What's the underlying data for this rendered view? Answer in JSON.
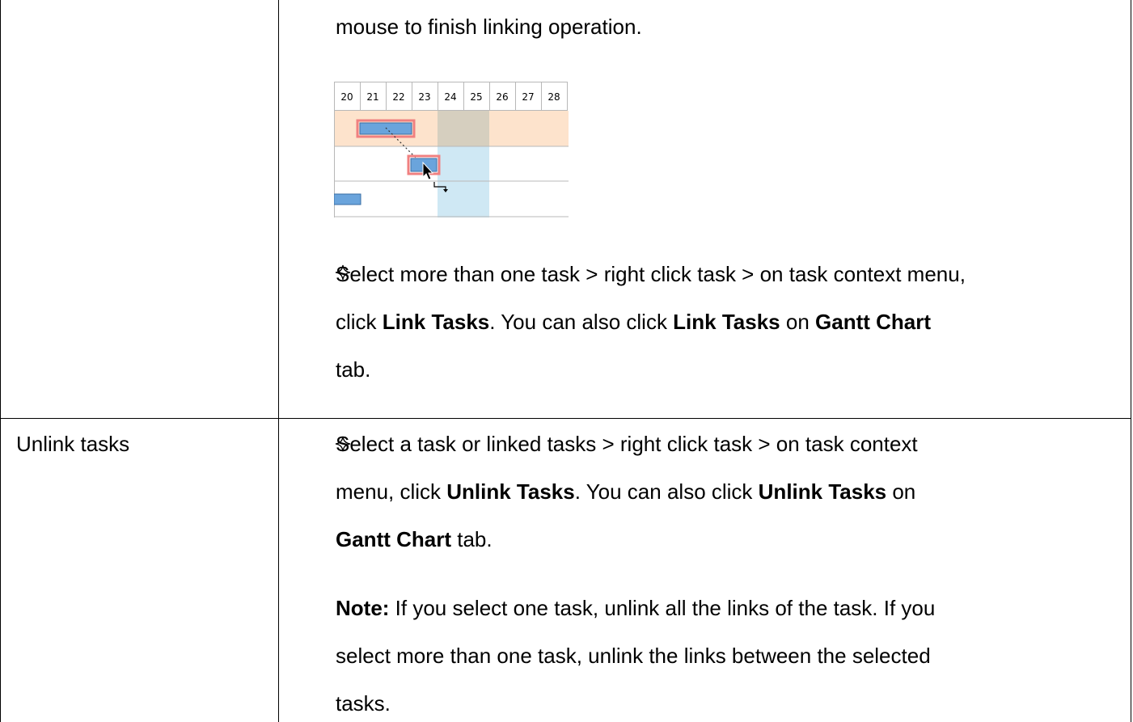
{
  "row1": {
    "continuation_text": "mouse to finish linking operation.",
    "bullet_icon": "four-point-star-outline-icon",
    "bullet_lines": [
      [
        "Select more than one task > right click task > on task context menu,"
      ],
      [
        "click ",
        {
          "b": "Link Tasks"
        },
        ". You can also click ",
        {
          "b": "Link Tasks"
        },
        " on ",
        {
          "b": "Gantt Chart"
        }
      ],
      [
        "tab."
      ]
    ]
  },
  "row2": {
    "label": "Unlink tasks",
    "bullet_icon": "four-point-star-outline-icon",
    "bullet_lines": [
      [
        "Select a task or linked tasks > right click task > on task context"
      ],
      [
        "menu, click ",
        {
          "b": "Unlink Tasks"
        },
        ". You can also click ",
        {
          "b": "Unlink Tasks"
        },
        " on"
      ],
      [
        {
          "b": "Gantt Chart"
        },
        " tab."
      ]
    ],
    "note_lines": [
      [
        {
          "b": "Note:"
        },
        " If you select one task, unlink all the links of the task. If you"
      ],
      [
        "select more than one task, unlink the links between the selected"
      ],
      [
        "tasks."
      ]
    ]
  },
  "gantt": {
    "days": [
      "20",
      "21",
      "22",
      "23",
      "24",
      "25",
      "26",
      "27",
      "28"
    ],
    "colors": {
      "highlight_row": "#fde3cc",
      "weekend_shade_top": "#d6cfbf",
      "weekend_shade": "#cfe8f4",
      "task_bar": "#6aa4dc",
      "selection_outline": "#f08080",
      "grid": "#b8b8b8"
    }
  }
}
